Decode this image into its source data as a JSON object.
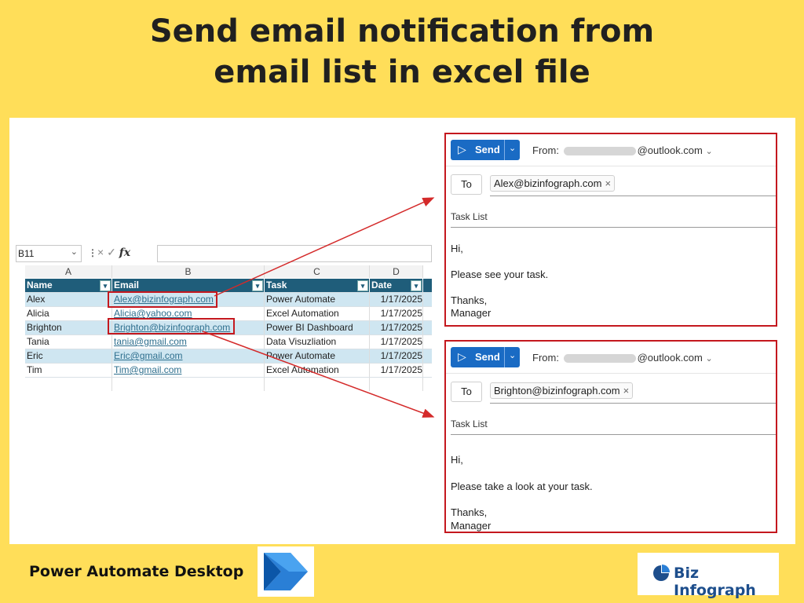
{
  "title": {
    "line1": "Send email notification from",
    "line2": "email list in excel file"
  },
  "excel": {
    "name_box": "B11",
    "formula_icons": {
      "cancel": "×",
      "enter": "✓",
      "fx": "fx"
    },
    "column_letters": [
      "A",
      "B",
      "C",
      "D"
    ],
    "headers": [
      "Name",
      "Email",
      "Task",
      "Date"
    ],
    "rows": [
      {
        "name": "Alex",
        "email": "Alex@bizinfograph.com",
        "task": "Power Automate",
        "date": "1/17/2025"
      },
      {
        "name": "Alicia",
        "email": "Alicia@yahoo.com",
        "task": "Excel Automation",
        "date": "1/17/2025"
      },
      {
        "name": "Brighton",
        "email": "Brighton@bizinfograph.com",
        "task": "Power BI Dashboard",
        "date": "1/17/2025"
      },
      {
        "name": "Tania",
        "email": "tania@gmail.com",
        "task": "Data Visuzliation",
        "date": "1/17/2025"
      },
      {
        "name": "Eric",
        "email": "Eric@gmail.com",
        "task": "Power Automate",
        "date": "1/17/2025"
      },
      {
        "name": "Tim",
        "email": "Tim@gmail.com",
        "task": "Excel Automation",
        "date": "1/17/2025"
      }
    ]
  },
  "email1": {
    "send_label": "Send",
    "from_label": "From:",
    "from_domain": "@outlook.com",
    "to_label": "To",
    "recipient": "Alex@bizinfograph.com",
    "subject": "Task List",
    "greeting": "Hi,",
    "message": "Please see your task.",
    "thanks": "Thanks,",
    "signature": "Manager"
  },
  "email2": {
    "send_label": "Send",
    "from_label": "From:",
    "from_domain": "@outlook.com",
    "to_label": "To",
    "recipient": "Brighton@bizinfograph.com",
    "subject": "Task List",
    "greeting": "Hi,",
    "message": "Please take a look at your task.",
    "thanks": "Thanks,",
    "signature": "Manager"
  },
  "footer": {
    "left_label": "Power Automate Desktop",
    "logo_text": "Biz Infograph"
  },
  "colors": {
    "background": "#FFDE59",
    "header_fill": "#1f5d7a",
    "band_fill": "#cfe6f1",
    "highlight": "#c4181e",
    "send_button": "#1a6bc4"
  }
}
